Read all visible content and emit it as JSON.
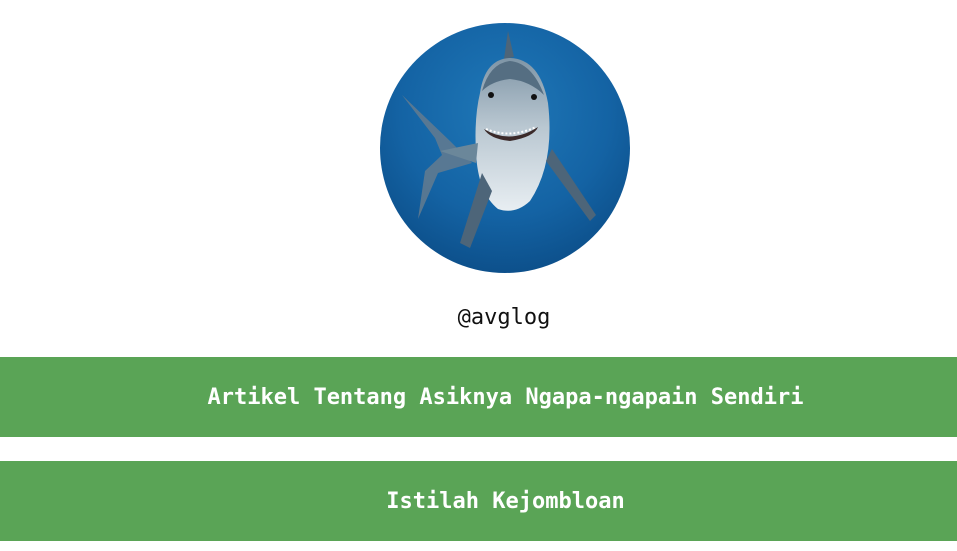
{
  "profile": {
    "username": "@avglog",
    "avatar_icon": "shark-photo"
  },
  "links": [
    {
      "label": "Artikel Tentang Asiknya Ngapa-ngapain Sendiri"
    },
    {
      "label": "Istilah Kejombloan"
    }
  ],
  "colors": {
    "button_bg": "#5aa456",
    "button_text": "#ffffff",
    "background": "#ffffff"
  }
}
